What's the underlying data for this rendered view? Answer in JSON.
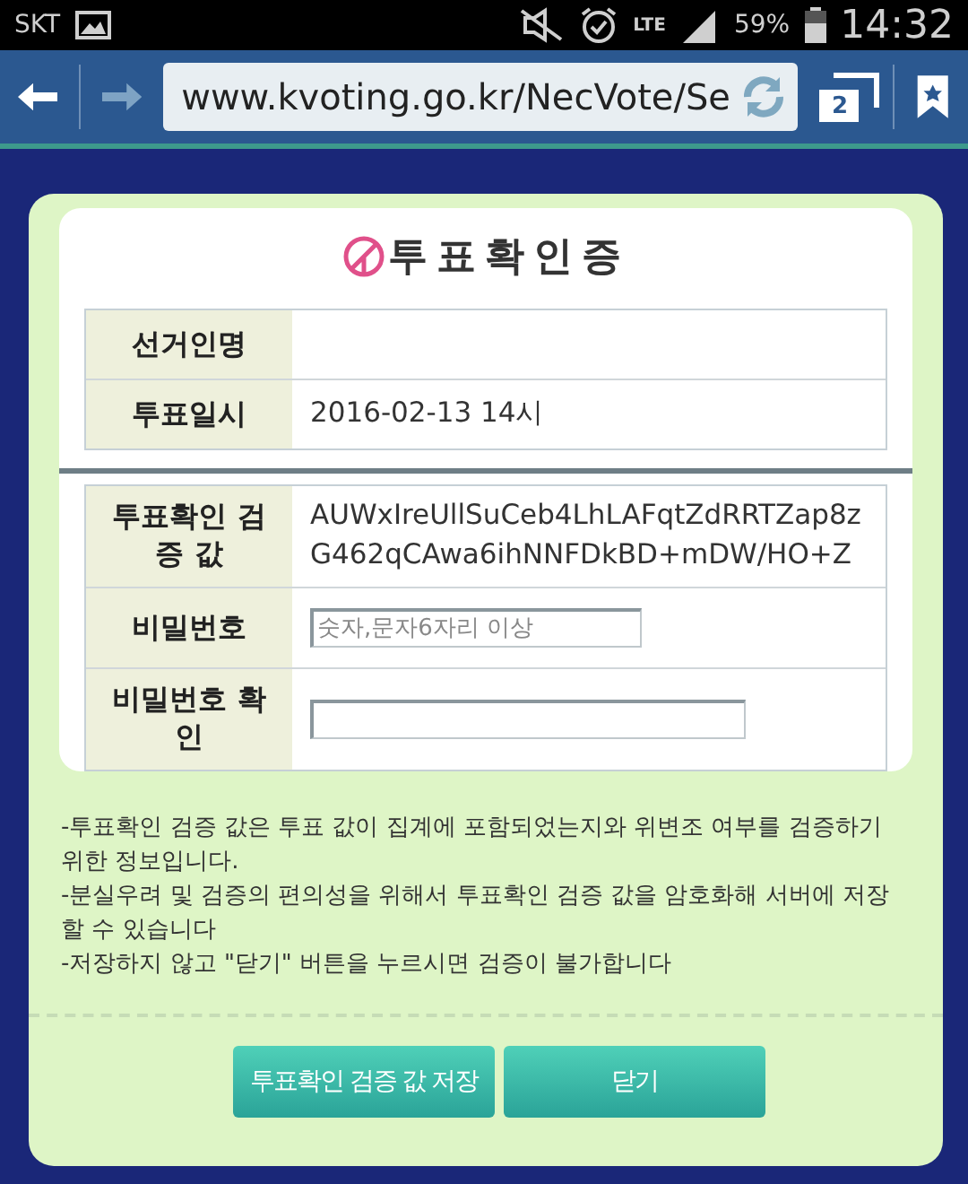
{
  "status_bar": {
    "carrier": "SKT",
    "network": "LTE",
    "battery": "59%",
    "time": "14:32"
  },
  "toolbar": {
    "url": "www.kvoting.go.kr/NecVote/Se",
    "tab_count": "2"
  },
  "dialog": {
    "title": "투표확인증",
    "info_rows": [
      {
        "label": "선거인명",
        "value": ""
      },
      {
        "label": "투표일시",
        "value": "2016-02-13 14시"
      }
    ],
    "detail_rows": [
      {
        "kind": "text",
        "label": "투표확인 검증 값",
        "value": "AUWxIreUllSuCeb4LhLAFqtZdRRTZap8zG462qCAwa6ihNNFDkBD+mDW/HO+Z"
      },
      {
        "kind": "field",
        "label": "비밀번호",
        "placeholder": "숫자,문자6자리 이상"
      },
      {
        "kind": "field",
        "label": "비밀번호 확인"
      }
    ],
    "notes": [
      "-투표확인 검증 값은 투표 값이 집계에 포함되었는지와 위변조 여부를 검증하기 위한 정보입니다.",
      "-분실우려 및 검증의 편의성을 위해서 투표확인 검증 값을 암호화해 서버에 저장할 수 있습니다",
      "-저장하지 않고 \"닫기\" 버튼을 누르시면 검증이 불가합니다"
    ],
    "buttons": [
      "투표확인 검증 값 저장",
      "닫기"
    ]
  }
}
